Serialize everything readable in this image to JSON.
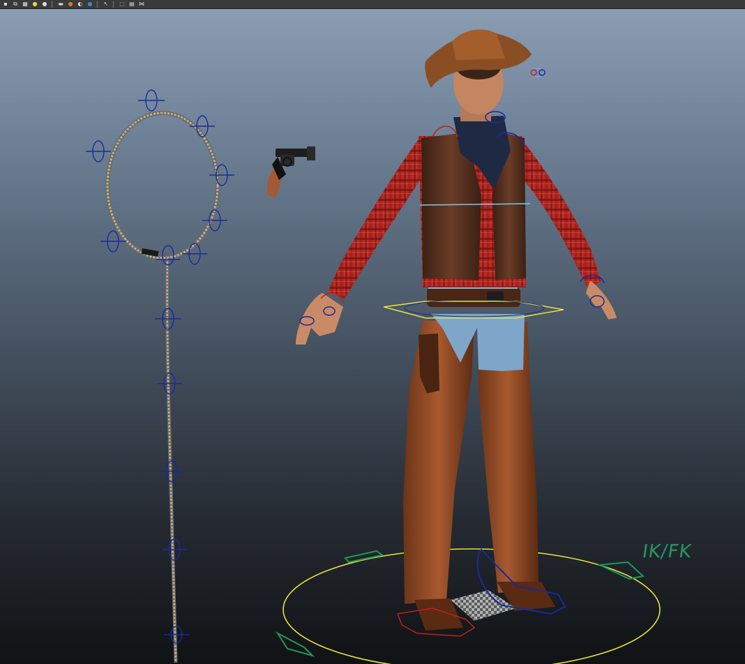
{
  "toolbar": {
    "icons": [
      {
        "name": "select-mode-icon",
        "glyph": "▪"
      },
      {
        "name": "cube-wireframe-icon",
        "glyph": "⧉"
      },
      {
        "name": "checker-icon",
        "glyph": "▦"
      },
      {
        "name": "light-bulb-icon",
        "glyph": "●",
        "color": "#e8d84a"
      },
      {
        "name": "default-light-icon",
        "glyph": "●",
        "color": "#d8d8d8"
      },
      {
        "name": "camera-icon",
        "glyph": "▬"
      },
      {
        "name": "shaded-sphere-icon",
        "glyph": "●",
        "color": "#d27a2a"
      },
      {
        "name": "xray-icon",
        "glyph": "◐"
      },
      {
        "name": "smooth-shade-icon",
        "glyph": "●",
        "color": "#4a7fd0"
      },
      {
        "name": "isolate-select-icon",
        "glyph": "↖"
      },
      {
        "name": "grid-cube-icon",
        "glyph": "⬚"
      },
      {
        "name": "layout-icon",
        "glyph": "▤"
      },
      {
        "name": "share-icon",
        "glyph": "⋈"
      }
    ]
  },
  "colors": {
    "control_blue": "#1a2a9a",
    "control_red": "#c41e1e",
    "control_yellow": "#e7e23a",
    "control_green": "#1e9a5a",
    "control_cyan": "#7fc8e8",
    "ikfk_green": "#2c8f64"
  },
  "rig": {
    "ikfk_label": "IK/FK"
  }
}
